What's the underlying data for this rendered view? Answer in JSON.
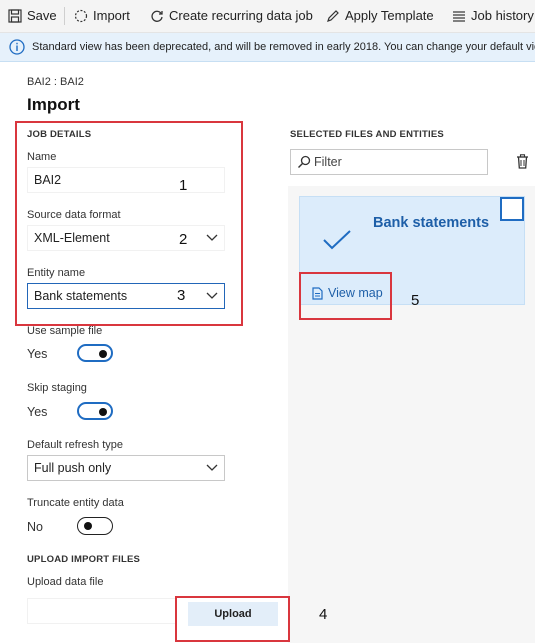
{
  "toolbar": {
    "save": "Save",
    "import": "Import",
    "recurring": "Create recurring data job",
    "template": "Apply Template",
    "history": "Job history"
  },
  "banner": {
    "text": "Standard view has been deprecated, and will be removed in early 2018. You can change your default view"
  },
  "page": {
    "breadcrumb": "BAI2 : BAI2",
    "title": "Import"
  },
  "job_details": {
    "section": "JOB DETAILS",
    "name_label": "Name",
    "name_value": "BAI2",
    "format_label": "Source data format",
    "format_value": "XML-Element",
    "entity_label": "Entity name",
    "entity_value": "Bank statements",
    "sample_label": "Use sample file",
    "sample_value": "Yes",
    "skip_label": "Skip staging",
    "skip_value": "Yes",
    "refresh_label": "Default refresh type",
    "refresh_value": "Full push only",
    "truncate_label": "Truncate entity data",
    "truncate_value": "No"
  },
  "upload": {
    "section": "UPLOAD IMPORT FILES",
    "file_label": "Upload data file",
    "button": "Upload"
  },
  "selected": {
    "section": "SELECTED FILES AND ENTITIES",
    "filter_placeholder": "Filter",
    "card_title": "Bank statements",
    "view_map": "View map"
  },
  "annotations": {
    "n1": "1",
    "n2": "2",
    "n3": "3",
    "n4": "4",
    "n5": "5"
  },
  "colors": {
    "accent": "#1f6cc2",
    "highlight": "#d9363e",
    "card_bg": "#dcecfb"
  },
  "toggles": {
    "sample_on": true,
    "skip_on": true,
    "truncate_on": false
  }
}
